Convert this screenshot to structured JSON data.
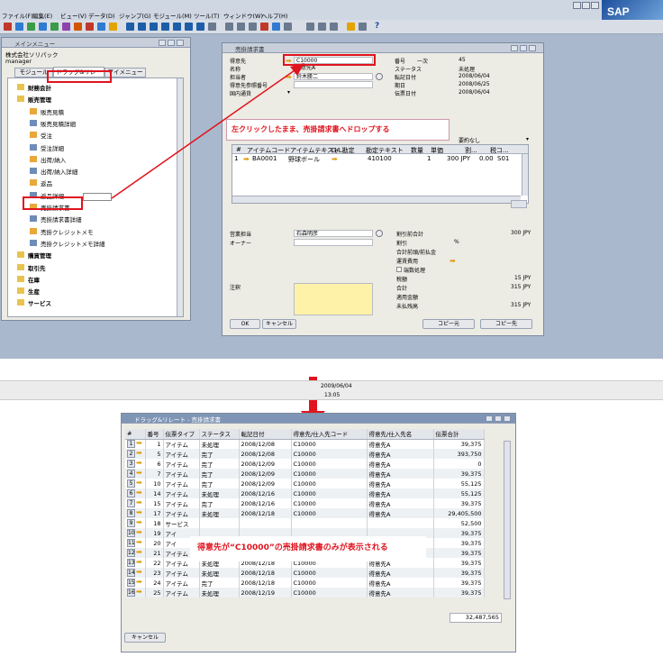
{
  "menu": {
    "items": [
      "ファイル(F)",
      "編集(E)",
      "ビュー(V)",
      "データ(D)",
      "ジャンプ(G)",
      "モジュール(M)",
      "ツール(T)",
      "ウィンドウ(W)",
      "ヘルプ(H)"
    ],
    "logo": "SAP"
  },
  "main_menu": {
    "title": "メインメニュー",
    "company": "株式会社ソリパック",
    "user": "manager",
    "tabs": [
      "モジュール",
      "ドラッグ&リレート",
      "マイメニュー"
    ],
    "items": [
      {
        "label": "財務会計",
        "type": "folder"
      },
      {
        "label": "販売管理",
        "type": "folder-open"
      },
      {
        "label": "販売見積",
        "type": "doc"
      },
      {
        "label": "販売見積詳細",
        "type": "list"
      },
      {
        "label": "受注",
        "type": "doc"
      },
      {
        "label": "受注詳細",
        "type": "list"
      },
      {
        "label": "出荷/納入",
        "type": "doc"
      },
      {
        "label": "出荷/納入詳細",
        "type": "list"
      },
      {
        "label": "返品",
        "type": "doc"
      },
      {
        "label": "返品詳細",
        "type": "list"
      },
      {
        "label": "売掛請求書",
        "type": "doc"
      },
      {
        "label": "売掛請求書詳細",
        "type": "list"
      },
      {
        "label": "売掛クレジットメモ",
        "type": "doc"
      },
      {
        "label": "売掛クレジットメモ詳細",
        "type": "list"
      },
      {
        "label": "購買管理",
        "type": "folder"
      },
      {
        "label": "取引先",
        "type": "folder"
      },
      {
        "label": "在庫",
        "type": "folder"
      },
      {
        "label": "生産",
        "type": "folder"
      },
      {
        "label": "サービス",
        "type": "folder"
      }
    ]
  },
  "invoice": {
    "title": "売掛請求書",
    "left_labels": [
      "得意先",
      "名称",
      "担当者",
      "得意先参照番号",
      "国内通貨"
    ],
    "customer_code": "C10000",
    "customer_name": "得意先A",
    "contact": "鈴木勝二",
    "right_labels": [
      "番号",
      "ステータス",
      "転記日付",
      "期日",
      "伝票日付"
    ],
    "number_series": "一次",
    "number": "45",
    "status": "未処理",
    "posting_date": "2008/06/04",
    "due_date": "2008/06/25",
    "doc_date": "2008/06/04",
    "summary_type": "要約なし",
    "grid_headers": [
      "#",
      "アイテムコード",
      "アイテムテキスト",
      "G/L勘定",
      "勘定テキスト",
      "数量",
      "単価",
      "割...",
      "税コ..."
    ],
    "row": {
      "num": "1",
      "code": "BA0001",
      "text": "野球ボール",
      "gl": "410100",
      "qty": "1",
      "price": "300 JPY",
      "disc": "0.00",
      "tax": "S01"
    },
    "sales_label": "営業担当",
    "sales_value": "石森明彦",
    "owner_label": "オーナー",
    "remarks_label": "注釈",
    "totals_labels": [
      "割引前合計",
      "割引",
      "合計前頭/前払金",
      "運賃費用",
      "端数処理",
      "税額",
      "合計",
      "適用金額",
      "未払残高"
    ],
    "discount_pct": "%",
    "totals": {
      "before_discount": "300 JPY",
      "tax": "15 JPY",
      "total": "315 JPY",
      "balance": "315 JPY"
    },
    "ok_button": "OK",
    "cancel_button": "キャンセル",
    "copy_from": "コピー元",
    "copy_to": "コピー先"
  },
  "annotations": {
    "drag_drop": "左クリックしたまま、売掛請求書へドロップする",
    "filter_note": "得意先が“C10000”の売掛請求書のみが表示される"
  },
  "status_strip": {
    "date": "2009/06/04",
    "time": "13:05"
  },
  "relate_window": {
    "title": "ドラッグ&リレート - 売掛請求書",
    "columns": [
      "#",
      "番号",
      "伝票タイプ",
      "ステータス",
      "転記日付",
      "得意先/仕入先コード",
      "得意先/仕入先名",
      "伝票合計"
    ],
    "rows": [
      {
        "n": "1",
        "num": "1",
        "type": "アイテム",
        "status": "未処理",
        "date": "2008/12/08",
        "code": "C10000",
        "name": "得意先A",
        "total": "39,375"
      },
      {
        "n": "2",
        "num": "5",
        "type": "アイテム",
        "status": "完了",
        "date": "2008/12/08",
        "code": "C10000",
        "name": "得意先A",
        "total": "393,750"
      },
      {
        "n": "3",
        "num": "6",
        "type": "アイテム",
        "status": "完了",
        "date": "2008/12/09",
        "code": "C10000",
        "name": "得意先A",
        "total": "0"
      },
      {
        "n": "4",
        "num": "7",
        "type": "アイテム",
        "status": "完了",
        "date": "2008/12/09",
        "code": "C10000",
        "name": "得意先A",
        "total": "39,375"
      },
      {
        "n": "5",
        "num": "10",
        "type": "アイテム",
        "status": "完了",
        "date": "2008/12/09",
        "code": "C10000",
        "name": "得意先A",
        "total": "55,125"
      },
      {
        "n": "6",
        "num": "14",
        "type": "アイテム",
        "status": "未処理",
        "date": "2008/12/16",
        "code": "C10000",
        "name": "得意先A",
        "total": "55,125"
      },
      {
        "n": "7",
        "num": "15",
        "type": "アイテム",
        "status": "完了",
        "date": "2008/12/16",
        "code": "C10000",
        "name": "得意先A",
        "total": "39,375"
      },
      {
        "n": "8",
        "num": "17",
        "type": "アイテム",
        "status": "未処理",
        "date": "2008/12/18",
        "code": "C10000",
        "name": "得意先A",
        "total": "29,405,500"
      },
      {
        "n": "9",
        "num": "18",
        "type": "サービス",
        "status": "",
        "date": "",
        "code": "",
        "name": "",
        "total": "52,500"
      },
      {
        "n": "10",
        "num": "19",
        "type": "アイ",
        "status": "",
        "date": "",
        "code": "",
        "name": "",
        "total": "39,375"
      },
      {
        "n": "11",
        "num": "20",
        "type": "アイ",
        "status": "",
        "date": "",
        "code": "",
        "name": "",
        "total": "39,375"
      },
      {
        "n": "12",
        "num": "21",
        "type": "アイテム",
        "status": "未処理",
        "date": "2008/12/18",
        "code": "C10000",
        "name": "得意先A",
        "total": "39,375"
      },
      {
        "n": "13",
        "num": "22",
        "type": "アイテム",
        "status": "未処理",
        "date": "2008/12/18",
        "code": "C10000",
        "name": "得意先A",
        "total": "39,375"
      },
      {
        "n": "14",
        "num": "23",
        "type": "アイテム",
        "status": "未処理",
        "date": "2008/12/18",
        "code": "C10000",
        "name": "得意先A",
        "total": "39,375"
      },
      {
        "n": "15",
        "num": "24",
        "type": "アイテム",
        "status": "完了",
        "date": "2008/12/18",
        "code": "C10000",
        "name": "得意先A",
        "total": "39,375"
      },
      {
        "n": "16",
        "num": "25",
        "type": "アイテム",
        "status": "未処理",
        "date": "2008/12/19",
        "code": "C10000",
        "name": "得意先A",
        "total": "39,375"
      }
    ],
    "grand_total": "32,487,565",
    "cancel_button": "キャンセル"
  },
  "colors": {
    "highlight": "#e0141e",
    "arrow_icon": "#e29a00",
    "desktop": "#a9b8cc"
  }
}
